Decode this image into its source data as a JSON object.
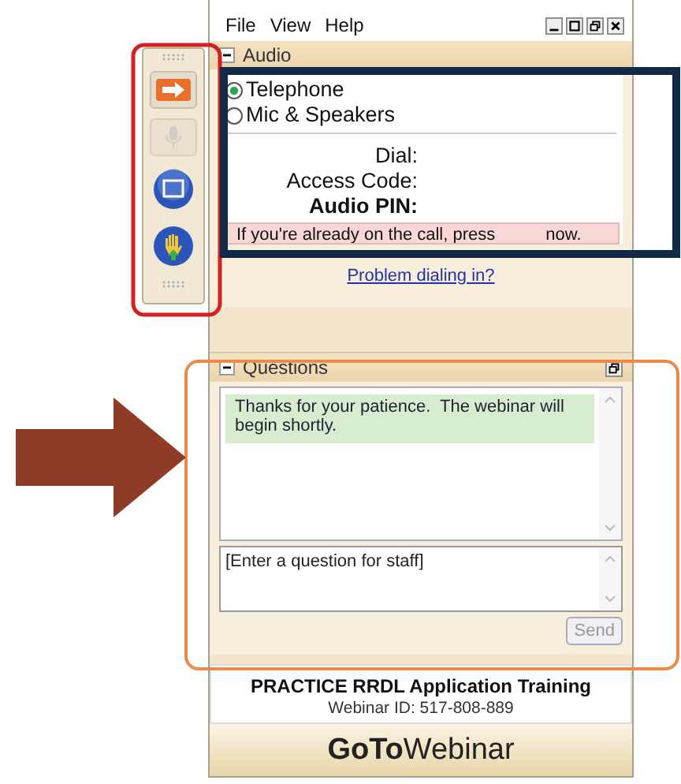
{
  "menu": [
    "File",
    "View",
    "Help"
  ],
  "toolbar": [
    {
      "kind": "arrow",
      "disabled": false
    },
    {
      "kind": "mic",
      "disabled": true
    },
    {
      "kind": "screen",
      "disabled": false
    },
    {
      "kind": "hand",
      "disabled": false
    }
  ],
  "audio": {
    "title": "Audio",
    "expanded": true,
    "options": [
      {
        "label": "Telephone",
        "selected": true
      },
      {
        "label": "Mic & Speakers",
        "selected": false
      }
    ],
    "fields": [
      {
        "label": "Dial:",
        "bold": false
      },
      {
        "label": "Access Code:",
        "bold": false
      },
      {
        "label": "Audio PIN:",
        "bold": true
      }
    ],
    "notice": [
      "If you're already on the call, press",
      "now."
    ],
    "link": "Problem dialing in?"
  },
  "questions": {
    "title": "Questions",
    "expanded": true,
    "messages": [
      "Thanks for your patience.  The webinar will begin shortly."
    ],
    "input": {
      "placeholder": "[Enter a question for staff]"
    },
    "send_button": {
      "label": "Send",
      "disabled": true
    }
  },
  "footer": {
    "title": "PRACTICE RRDL Application Training",
    "webinar_id": "Webinar ID: 517-808-889",
    "logo": "**GoTo**Webinar"
  }
}
